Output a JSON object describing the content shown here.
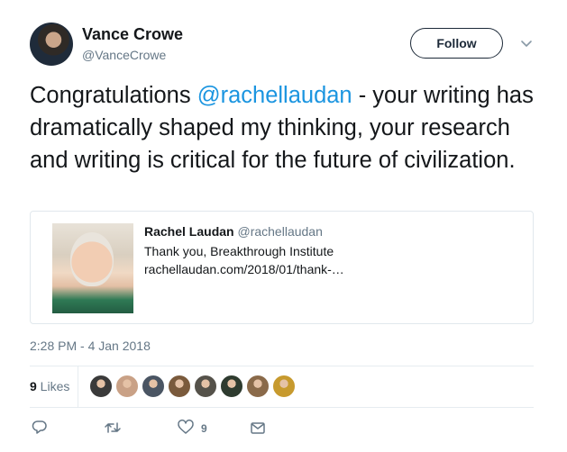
{
  "author": {
    "name": "Vance Crowe",
    "handle": "@VanceCrowe"
  },
  "follow_label": "Follow",
  "tweet": {
    "text_before": "Congratulations ",
    "mention": "@rachellaudan",
    "text_after": " - your writing has dramatically shaped my thinking, your research and writing is critical for the future of civilization."
  },
  "quoted": {
    "name": "Rachel Laudan",
    "handle": "@rachellaudan",
    "text": "Thank you, Breakthrough Institute",
    "link": "rachellaudan.com/2018/01/thank-…"
  },
  "timestamp": "2:28 PM - 4 Jan 2018",
  "stats": {
    "likes_count": "9",
    "likes_label": " Likes"
  },
  "likers": [
    {
      "color": "#3a3a3a"
    },
    {
      "color": "#c9a186"
    },
    {
      "color": "#4a5563"
    },
    {
      "color": "#7a5a3c"
    },
    {
      "color": "#55524a"
    },
    {
      "color": "#2e3b2f"
    },
    {
      "color": "#8a6a4a"
    },
    {
      "color": "#c79a2e"
    }
  ],
  "actions": {
    "reply": "reply-icon",
    "retweet": "retweet-icon",
    "like": "heart-icon",
    "like_count": "9",
    "message": "envelope-icon"
  }
}
